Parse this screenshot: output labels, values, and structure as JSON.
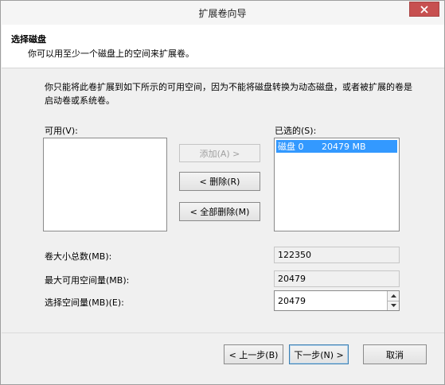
{
  "window": {
    "title": "扩展卷向导",
    "close_icon": "close-icon"
  },
  "header": {
    "title": "选择磁盘",
    "subtitle": "你可以用至少一个磁盘上的空间来扩展卷。"
  },
  "description": "你只能将此卷扩展到如下所示的可用空间，因为不能将磁盘转换为动态磁盘，或者被扩展的卷是启动卷或系统卷。",
  "available": {
    "label": "可用(V):",
    "items": []
  },
  "selected": {
    "label": "已选的(S):",
    "items": [
      {
        "disk": "磁盘 0",
        "size": "20479 MB"
      }
    ]
  },
  "move_buttons": {
    "add": "添加(A) >",
    "remove": "< 删除(R)",
    "remove_all": "< 全部删除(M)"
  },
  "fields": {
    "total_label": "卷大小总数(MB):",
    "total_value": "122350",
    "max_label": "最大可用空间量(MB):",
    "max_value": "20479",
    "select_label": "选择空间量(MB)(E):",
    "select_value": "20479"
  },
  "nav_buttons": {
    "back": "< 上一步(B)",
    "next": "下一步(N) >",
    "cancel": "取消"
  },
  "colors": {
    "close_button": "#c75050",
    "selection": "#3399ff"
  }
}
